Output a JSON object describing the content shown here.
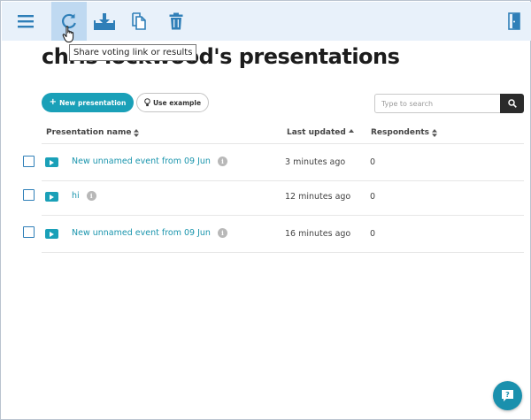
{
  "toolbar": {
    "menu_icon": "hamburger-menu-icon",
    "share_icon": "refresh-share-icon",
    "download_icon": "download-icon",
    "copy_icon": "copy-icon",
    "delete_icon": "trash-icon",
    "exit_icon": "exit-door-icon"
  },
  "tooltip": "Share voting link or results",
  "page_title": "chris lockwood's presentations",
  "actions": {
    "new_presentation": "New presentation",
    "use_example": "Use example"
  },
  "search": {
    "placeholder": "Type to search"
  },
  "table": {
    "headers": {
      "name": "Presentation name",
      "updated": "Last updated",
      "respondents": "Respondents"
    },
    "rows": [
      {
        "name": "New unnamed event from 09 Jun",
        "updated": "3 minutes ago",
        "respondents": "0"
      },
      {
        "name": "hi",
        "updated": "12 minutes ago",
        "respondents": "0"
      },
      {
        "name": "New unnamed event from 09 Jun",
        "updated": "16 minutes ago",
        "respondents": "0"
      }
    ]
  },
  "info_glyph": "i",
  "colors": {
    "accent": "#1aa0b8",
    "toolbar_bg": "#e8f1fa",
    "icon_blue": "#2f7fb8"
  }
}
